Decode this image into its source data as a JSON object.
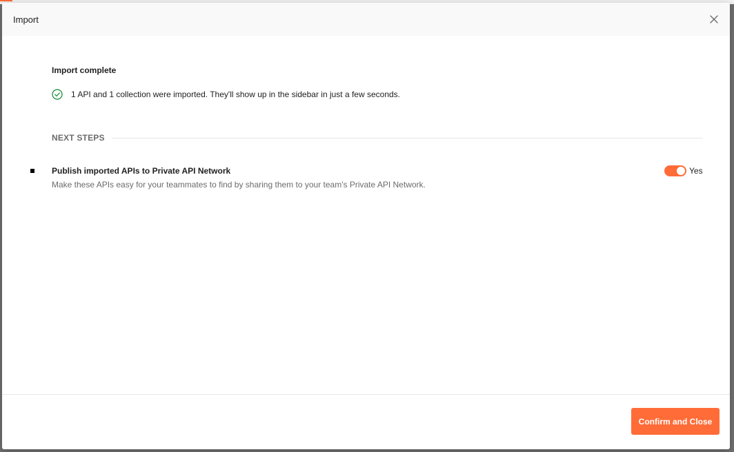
{
  "modal": {
    "title": "Import",
    "close_icon": "close-icon"
  },
  "result": {
    "heading": "Import complete",
    "status_icon": "check-circle-icon",
    "status_color": "#0c8a2e",
    "message": "1 API and 1 collection were imported. They'll show up in the sidebar in just a few seconds."
  },
  "next_steps": {
    "label": "NEXT STEPS",
    "items": [
      {
        "title": "Publish imported APIs to Private API Network",
        "description": "Make these APIs easy for your teammates to find by sharing them to your team's Private API Network.",
        "toggle_on": true,
        "toggle_label": "Yes"
      }
    ]
  },
  "footer": {
    "confirm_label": "Confirm and Close"
  },
  "colors": {
    "accent": "#ff6c37"
  }
}
